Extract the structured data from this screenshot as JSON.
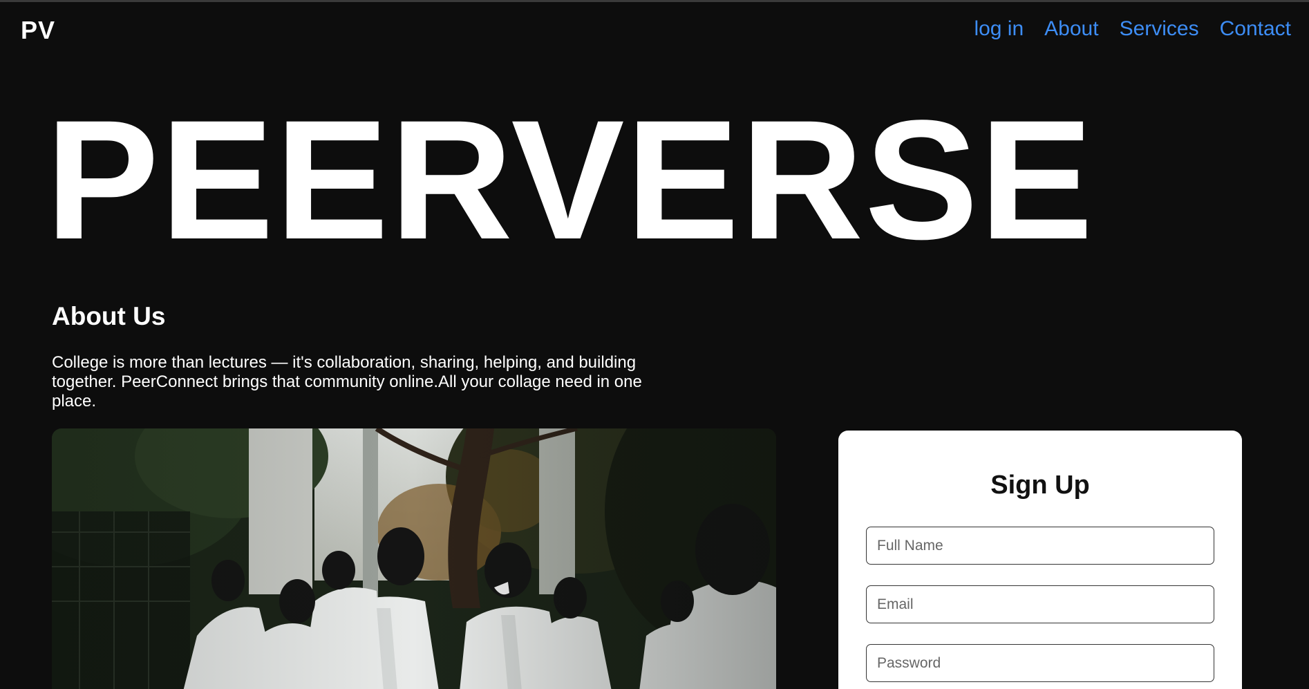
{
  "header": {
    "logo": "PV",
    "nav": [
      "log in",
      "About",
      "Services",
      "Contact"
    ]
  },
  "hero": {
    "title": "PEERVERSE"
  },
  "about": {
    "title": "About Us",
    "text": "College is more than lectures — it's collaboration, sharing, helping, and building together. PeerConnect brings that community online.All your collage need in one place."
  },
  "photo": {
    "subject": "students-in-white-shirts-walking-photo"
  },
  "signup": {
    "title": "Sign Up",
    "name_placeholder": "Full Name",
    "email_placeholder": "Email",
    "password_placeholder": "Password"
  },
  "colors": {
    "background": "#0d0d0d",
    "nav_link": "#3d8df5",
    "text": "#ffffff",
    "card": "#ffffff"
  }
}
